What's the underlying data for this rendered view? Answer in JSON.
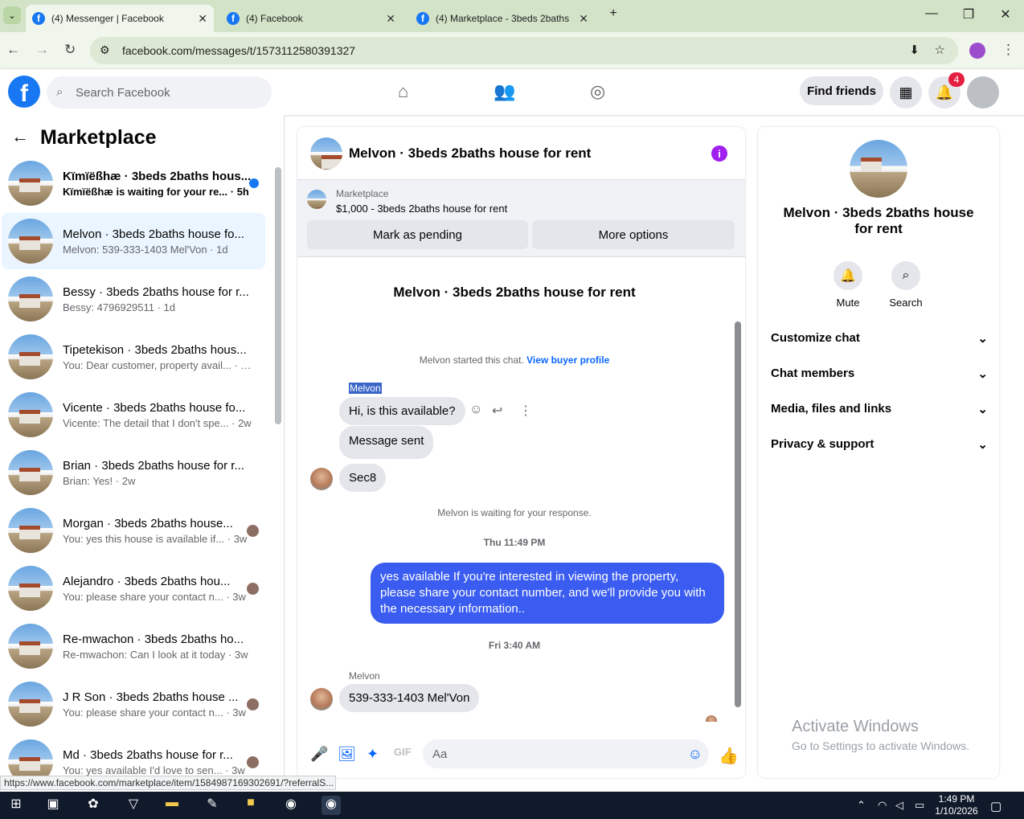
{
  "browser": {
    "tabs": [
      {
        "title": "(4) Messenger | Facebook"
      },
      {
        "title": "(4) Facebook"
      },
      {
        "title": "(4) Marketplace - 3beds 2baths"
      }
    ],
    "url": "facebook.com/messages/t/1573112580391327",
    "status_url": "https://www.facebook.com/marketplace/item/1584987169302691/?referralS..."
  },
  "fb": {
    "search_placeholder": "Search Facebook",
    "find_friends": "Find friends",
    "notif_count": "4"
  },
  "sidebar": {
    "title": "Marketplace",
    "conversations": [
      {
        "name": "Kïmïëßhæ · 3beds 2baths hous...",
        "preview": "Kïmïëßhæ is waiting for your re... · 5h",
        "unread": true
      },
      {
        "name": "Melvon · 3beds 2baths house fo...",
        "preview": "Melvon: 539-333-1403 Mel'Von · 1d"
      },
      {
        "name": "Bessy · 3beds 2baths house for r...",
        "preview": "Bessy: 4796929511 · 1d"
      },
      {
        "name": "Tipetekison · 3beds 2baths hous...",
        "preview": "You: Dear customer, property avail... · 2w"
      },
      {
        "name": "Vicente · 3beds 2baths house fo...",
        "preview": "Vicente: The detail that I don't spe... · 2w"
      },
      {
        "name": "Brian · 3beds 2baths house for r...",
        "preview": "Brian: Yes! · 2w"
      },
      {
        "name": "Morgan · 3beds 2baths house...",
        "preview": "You: yes this house is available if... · 3w"
      },
      {
        "name": "Alejandro · 3beds 2baths hou...",
        "preview": "You: please share your contact n... · 3w"
      },
      {
        "name": "Re-mwachon · 3beds 2baths ho...",
        "preview": "Re-mwachon: Can I look at it today · 3w"
      },
      {
        "name": "J R Son · 3beds 2baths house ...",
        "preview": "You: please share your contact n... · 3w"
      },
      {
        "name": "Md · 3beds 2baths house for r...",
        "preview": "You: yes available I'd love to sen... · 3w"
      }
    ]
  },
  "chat": {
    "title": "Melvon · 3beds 2baths house for rent",
    "market_label": "Marketplace",
    "listing": "$1,000 - 3beds 2baths house for rent",
    "mark_pending": "Mark as pending",
    "more_options": "More options",
    "header_title": "Melvon · 3beds 2baths house for rent",
    "started": "Melvon started this chat.",
    "view_profile": "View buyer profile",
    "sender": "Melvon",
    "msg1": "Hi, is this available?",
    "msg2": "Message sent",
    "msg3": "Sec8",
    "waiting": "Melvon is waiting for your response.",
    "time1": "Thu 11:49 PM",
    "my_msg": "yes available  If you're interested in viewing the property, please share your contact number, and we'll provide you with the necessary information..",
    "time2": "Fri 3:40 AM",
    "sender2": "Melvon",
    "msg4": "539-333-1403 Mel'Von",
    "compose_placeholder": "Aa"
  },
  "details": {
    "name": "Melvon · 3beds 2baths house for rent",
    "mute": "Mute",
    "search": "Search",
    "sections": [
      "Customize chat",
      "Chat members",
      "Media, files and links",
      "Privacy & support"
    ]
  },
  "watermark": {
    "line1": "Activate Windows",
    "line2": "Go to Settings to activate Windows."
  },
  "taskbar": {
    "time": "1:49 PM",
    "date": "1/10/2026"
  }
}
